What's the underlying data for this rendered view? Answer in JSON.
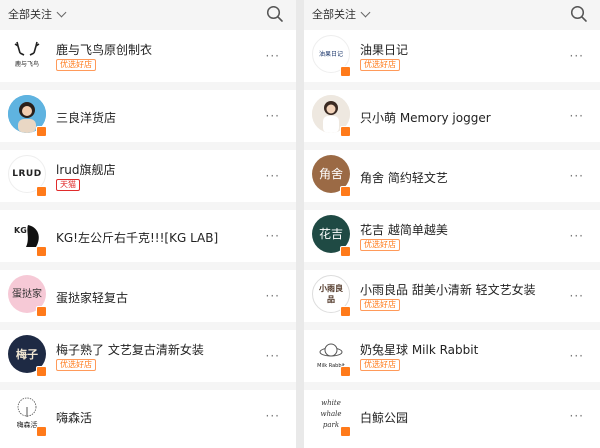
{
  "left": {
    "filter_label": "全部关注",
    "shops": [
      {
        "name": "鹿与飞鸟原创制衣",
        "tag": "优选好店",
        "tag_type": "badge",
        "avatar": {
          "style": "antlers",
          "text": "鹿与飞鸟"
        }
      },
      {
        "name": "三良洋货店",
        "tag": "",
        "tag_type": "none",
        "avatar": {
          "style": "photo-girl",
          "text": ""
        }
      },
      {
        "name": "lrud旗舰店",
        "tag": "天猫",
        "tag_type": "tmall",
        "avatar": {
          "style": "text",
          "text": "LRUD"
        }
      },
      {
        "name": "KG!左公斤右千克!!![KG LAB]",
        "tag": "",
        "tag_type": "none",
        "avatar": {
          "style": "kg",
          "text": "KG"
        }
      },
      {
        "name": "蛋挞家轻复古",
        "tag": "",
        "tag_type": "none",
        "avatar": {
          "style": "pink",
          "text": "蛋挞家"
        }
      },
      {
        "name": "梅子熟了 文艺复古清新女装",
        "tag": "优选好店",
        "tag_type": "badge",
        "avatar": {
          "style": "navy",
          "text": "梅子"
        }
      },
      {
        "name": "嗨森活",
        "tag": "",
        "tag_type": "none",
        "avatar": {
          "style": "tree",
          "text": "嗨森活"
        }
      }
    ]
  },
  "right": {
    "filter_label": "全部关注",
    "shops": [
      {
        "name": "油果日记",
        "tag": "优选好店",
        "tag_type": "badge",
        "avatar": {
          "style": "youguo",
          "text": "油果日记"
        }
      },
      {
        "name": "只小萌 Memory jogger",
        "tag": "",
        "tag_type": "none",
        "avatar": {
          "style": "photo-girl2",
          "text": ""
        }
      },
      {
        "name": "角舍 简约轻文艺",
        "tag": "",
        "tag_type": "none",
        "avatar": {
          "style": "brown",
          "text": "角舍"
        }
      },
      {
        "name": "花吉 越简单越美",
        "tag": "优选好店",
        "tag_type": "badge",
        "avatar": {
          "style": "teal",
          "text": "花吉"
        }
      },
      {
        "name": "小雨良品 甜美小清新 轻文艺女装",
        "tag": "优选好店",
        "tag_type": "badge",
        "avatar": {
          "style": "stamp",
          "text": "小雨良品"
        }
      },
      {
        "name": "奶兔星球 Milk Rabbit",
        "tag": "优选好店",
        "tag_type": "badge",
        "avatar": {
          "style": "rabbit",
          "text": "Milk Rabbit"
        }
      },
      {
        "name": "白鲸公园",
        "tag": "",
        "tag_type": "none",
        "avatar": {
          "style": "script",
          "text": "white whale park"
        }
      }
    ]
  },
  "more_glyph": "···",
  "colors": {
    "accent": "#ff7a1a",
    "tmall": "#e02b2b",
    "background": "#f5f5f5",
    "card": "#ffffff"
  }
}
